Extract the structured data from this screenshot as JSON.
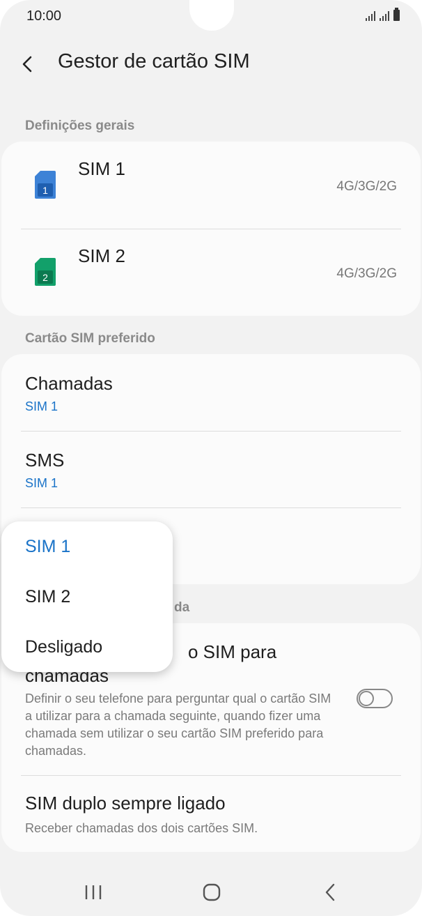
{
  "status": {
    "time": "10:00"
  },
  "header": {
    "title": "Gestor de cartão SIM"
  },
  "sections": {
    "general": "Definições gerais",
    "preferred": "Cartão SIM preferido",
    "partial_hidden": "da"
  },
  "sims": [
    {
      "name": "SIM 1",
      "network": "4G/3G/2G",
      "badge": "1",
      "color": "#3d82d6"
    },
    {
      "name": "SIM 2",
      "network": "4G/3G/2G",
      "badge": "2",
      "color": "#12a06a"
    }
  ],
  "preferred": [
    {
      "title": "Chamadas",
      "value": "SIM 1"
    },
    {
      "title": "SMS",
      "value": "SIM 1"
    }
  ],
  "ask_sim": {
    "title_visible": "o SIM para",
    "title_line2": "chamadas",
    "description": "Definir o seu telefone para perguntar qual o cartão SIM a utilizar para a chamada seguinte, quando fizer uma chamada sem utilizar o seu cartão SIM preferido para chamadas.",
    "enabled": false
  },
  "dual_sim": {
    "title": "SIM duplo sempre ligado",
    "description": "Receber chamadas dos dois cartões SIM."
  },
  "popup": {
    "options": [
      "SIM 1",
      "SIM 2",
      "Desligado"
    ],
    "selected": "SIM 1"
  },
  "colors": {
    "accent": "#1a73c8"
  }
}
